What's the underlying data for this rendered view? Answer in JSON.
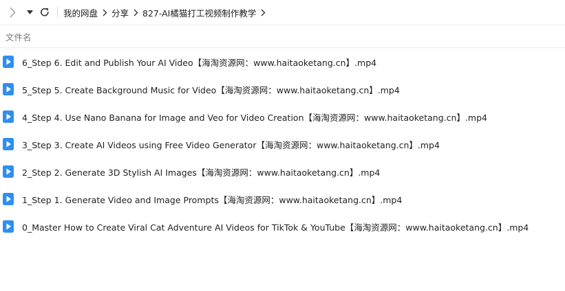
{
  "toolbar": {
    "forward_icon": "chevron-right-icon",
    "dropdown_icon": "caret-down-icon",
    "refresh_icon": "refresh-icon",
    "breadcrumb": [
      "我的网盘",
      "分享",
      "827-AI橘猫打工视频制作教学"
    ],
    "breadcrumb_separator_icon": "chevron-right-icon"
  },
  "list_header": {
    "name_column": "文件名"
  },
  "files": [
    {
      "name": "6_Step 6. Edit and Publish Your AI Video【海淘资源网：www.haitaoketang.cn】.mp4",
      "icon": "video-file-icon"
    },
    {
      "name": "5_Step 5. Create Background Music for Video【海淘资源网：www.haitaoketang.cn】.mp4",
      "icon": "video-file-icon"
    },
    {
      "name": "4_Step 4. Use Nano Banana for Image and Veo for Video Creation【海淘资源网：www.haitaoketang.cn】.mp4",
      "icon": "video-file-icon"
    },
    {
      "name": "3_Step 3. Create AI Videos using Free Video Generator【海淘资源网：www.haitaoketang.cn】.mp4",
      "icon": "video-file-icon"
    },
    {
      "name": "2_Step 2. Generate 3D Stylish AI Images【海淘资源网：www.haitaoketang.cn】.mp4",
      "icon": "video-file-icon"
    },
    {
      "name": "1_Step 1. Generate Video and Image Prompts【海淘资源网：www.haitaoketang.cn】.mp4",
      "icon": "video-file-icon"
    },
    {
      "name": "0_Master How to Create  Viral Cat Adventure AI Videos for TikTok & YouTube【海淘资源网：www.haitaoketang.cn】.mp4",
      "icon": "video-file-icon"
    }
  ],
  "colors": {
    "icon_blue": "#2f8ff0",
    "text": "#222222",
    "header_text": "#777777",
    "divider": "#ececec"
  }
}
